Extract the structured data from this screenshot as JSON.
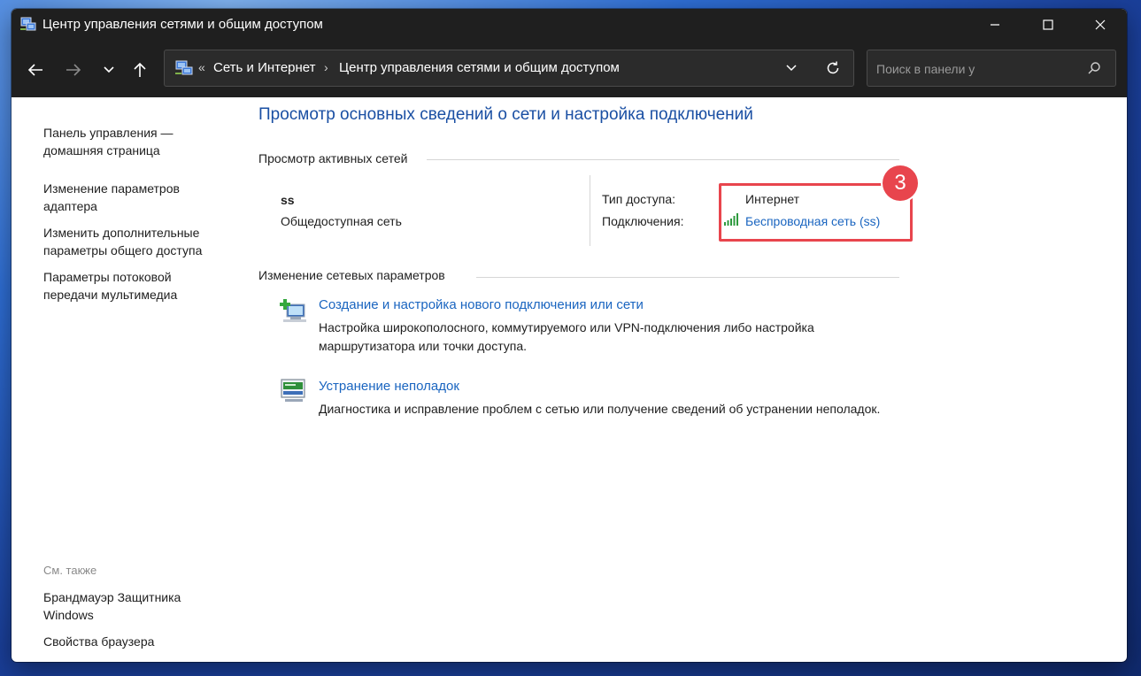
{
  "window": {
    "title": "Центр управления сетями и общим доступом",
    "controls": {
      "minimize": "minimize",
      "maximize": "maximize",
      "close": "close"
    }
  },
  "navigation": {
    "back_icon": "arrow-left-icon",
    "forward_icon": "arrow-right-icon",
    "recent_icon": "chevron-down-icon",
    "up_icon": "arrow-up-icon"
  },
  "address_bar": {
    "overflow": "«",
    "crumbs": [
      "Сеть и Интернет",
      "Центр управления сетями и общим доступом"
    ],
    "separator": "›"
  },
  "search": {
    "placeholder": "Поиск в панели у"
  },
  "sidebar": {
    "links": [
      "Панель управления — домашняя страница",
      "Изменение параметров адаптера",
      "Изменить дополнительные параметры общего доступа",
      "Параметры потоковой передачи мультимедиа"
    ],
    "see_also_label": "См. также",
    "see_also": [
      "Брандмауэр Защитника Windows",
      "Свойства браузера"
    ]
  },
  "main": {
    "title": "Просмотр основных сведений о сети и настройка подключений",
    "active_networks": {
      "heading": "Просмотр активных сетей",
      "network_name": "ss",
      "network_profile": "Общедоступная сеть",
      "access_type_label": "Тип доступа:",
      "access_type_value": "Интернет",
      "connections_label": "Подключения:",
      "connections_value": "Беспроводная сеть (ss)"
    },
    "annotation_badge": "3",
    "change_settings": {
      "heading": "Изменение сетевых параметров",
      "tasks": [
        {
          "title": "Создание и настройка нового подключения или сети",
          "description": "Настройка широкополосного, коммутируемого или VPN-подключения либо настройка маршрутизатора или точки доступа."
        },
        {
          "title": "Устранение неполадок",
          "description": "Диагностика и исправление проблем с сетью или получение сведений об устранении неполадок."
        }
      ]
    }
  },
  "colors": {
    "link": "#1a65c0",
    "title": "#1a4fa3",
    "highlight": "#e8454d",
    "titlebar": "#1f1f1f"
  }
}
